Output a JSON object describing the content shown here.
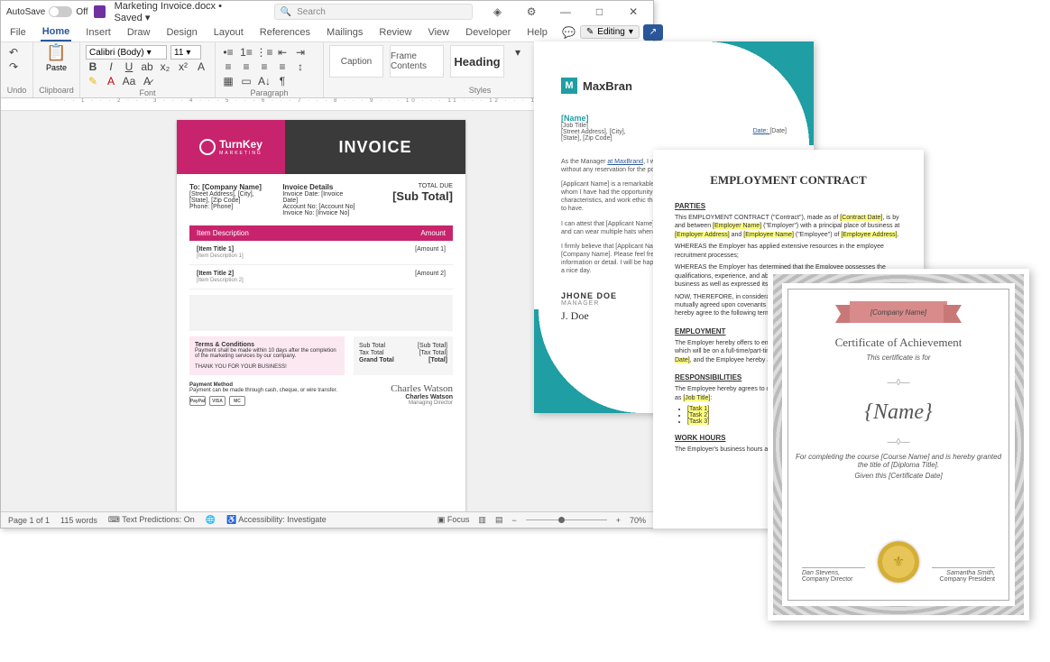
{
  "word": {
    "autosave_label": "AutoSave",
    "autosave_state": "Off",
    "doc_name": "Marketing Invoice.docx",
    "save_state": "Saved",
    "search_placeholder": "Search",
    "menu": {
      "file": "File",
      "home": "Home",
      "insert": "Insert",
      "draw": "Draw",
      "design": "Design",
      "layout": "Layout",
      "references": "References",
      "mailings": "Mailings",
      "review": "Review",
      "view": "View",
      "developer": "Developer",
      "help": "Help"
    },
    "editing_btn": "Editing",
    "ribbon": {
      "undo": "Undo",
      "clipboard": "Clipboard",
      "paste": "Paste",
      "font": "Font",
      "font_name": "Calibri (Body)",
      "font_size": "11",
      "paragraph": "Paragraph",
      "styles": "Styles",
      "style_items": [
        "Caption",
        "Frame Contents",
        "Heading"
      ]
    },
    "ruler": "· · · 1 · · · 2 · · · 3 · · · 4 · · · 5 · · · 6 · · · 7 · · · 8 · · · 9 · · · 10 · · · 11 · · · 12 · · · 13 · · · 14 · · · 15 · · · 16 · · · 17 · · · 18",
    "status": {
      "pages": "Page 1 of 1",
      "words": "115 words",
      "predictions": "Text Predictions: On",
      "accessibility": "Accessibility: Investigate",
      "focus": "Focus",
      "zoom": "70%"
    }
  },
  "invoice": {
    "brand": "TurnKey",
    "brand_sub": "MARKETING",
    "title": "INVOICE",
    "to_lbl": "To: [Company Name]",
    "to_lines": [
      "[Street Address], [City],",
      "[State], [Zip Code]",
      "Phone: [Phone]"
    ],
    "det_lbl": "Invoice Details",
    "det_lines": [
      "Invoice Date: [Invoice Date]",
      "Account No: [Account No]",
      "Invoice No: [Invoice No]"
    ],
    "total_due": "TOTAL DUE",
    "subtotal": "[Sub Total]",
    "col_desc": "Item Description",
    "col_amt": "Amount",
    "items": [
      {
        "title": "[Item Title 1]",
        "desc": "[Item Description 1]",
        "amt": "[Amount 1]"
      },
      {
        "title": "[Item Title 2]",
        "desc": "[Item Description 2]",
        "amt": "[Amount 2]"
      }
    ],
    "tc_title": "Terms & Conditions",
    "tc_body": "Payment shall be made within 10 days after the completion of the marketing services by our company.",
    "tc_thanks": "THANK YOU FOR YOUR BUSINESS!",
    "tot": {
      "sub_l": "Sub Total",
      "sub_v": "[Sub Total]",
      "tax_l": "Tax Total",
      "tax_v": "[Tax Total]",
      "gt_l": "Grand Total",
      "gt_v": "[Total]"
    },
    "pay_title": "Payment Method",
    "pay_body": "Payment can be made through cash, cheque, or wire transfer.",
    "pay_icons": [
      "PayPal",
      "VISA",
      "MC"
    ],
    "sig_script": "Charles Watson",
    "sig_name": "Charles Watson",
    "sig_role": "Managing Director"
  },
  "letter": {
    "brand": "MaxBran",
    "name": "[Name]",
    "lines": [
      "[Job Title]",
      "[Street Address], [City],",
      "[State], [Zip Code]"
    ],
    "date_lbl": "Date: ",
    "date_val": "[Date]",
    "paras": [
      "As the Manager at MaxBrand, I would like to recommend [Applicant Name] without any reservation for the position.",
      "[Applicant Name] is a remarkable individual and one of the best employees with whom I have had the opportunity to work. He/She embodies all the values, characteristics, and work ethic that any employer could want and should aspire to have.",
      "I can attest that [Applicant Name] is a dedicated worker who handles tasks deftly and can wear multiple hats when required. Your gain will certainly be your gain.",
      "I firmly believe that [Applicant Name] will be an outstanding addition to [Company Name]. Please feel free to contact me should you need more information or detail. I will be happy to assist. Thank you for your time and have a nice day."
    ],
    "sig_name": "JHONE DOE",
    "sig_role": "MANAGER"
  },
  "contract": {
    "title": "EMPLOYMENT CONTRACT",
    "h_parties": "PARTIES",
    "p1_a": "This EMPLOYMENT CONTRACT (\"Contract\"), made as of ",
    "p1_b": "[Contract Date]",
    "p1_c": ", is by and between ",
    "p1_d": "[Employer Name]",
    "p1_e": " (\"Employer\") with a principal place of business at ",
    "p1_f": "[Employer Address]",
    "p1_g": " and ",
    "p1_h": "[Employee Name]",
    "p1_i": " (\"Employee\") of ",
    "p1_j": "[Employee Address]",
    "p1_k": ".",
    "p2": "WHEREAS the Employer has applied extensive resources in the employee recruitment processes;",
    "p3": "WHEREAS the Employer has determined that the Employee possesses the qualifications, experience, and abilities necessary to carry out the Employer's business as well as expressed its wish to employ the Employee;",
    "p4": "NOW, THEREFORE, in consideration of the promises, rights, and obligations mutually agreed upon covenants made and set forth hereinafter, the parties hereby agree to the following terms and conditions:",
    "h_emp": "EMPLOYMENT",
    "p5_a": "The Employer hereby offers to employ the Employee in the position of ",
    "p5_b": "[Job Title]",
    "p5_c": ", which will be on a full-time/part-time basis and is due to commence on ",
    "p5_d": "[Start Date]",
    "p5_e": ", and the Employee hereby accepts this Contract for any such reasons.",
    "h_resp": "RESPONSIBILITIES",
    "p6_a": "The Employee hereby agrees to carry out the following duties and responsibilities as ",
    "p6_b": "[Job Title]",
    "p6_c": ":",
    "tasks": [
      "[Task 1]",
      "[Task 2]",
      "[Task 3]"
    ],
    "h_hours": "WORK HOURS",
    "p7": "The Employer's business hours are from [Start Time] to [End Time]."
  },
  "cert": {
    "banner": "[Company Name]",
    "title": "Certificate of Achievement",
    "sub": "This certificate is for",
    "name": "{Name}",
    "line1": "For completing the course [Course Name] and is hereby granted the title of [Diploma Title].",
    "line2": "Given this [Certificate Date]",
    "sig1_name": "Dan Stevens,",
    "sig1_role": "Company Director",
    "sig2_name": "Samantha Smith,",
    "sig2_role": "Company President"
  }
}
